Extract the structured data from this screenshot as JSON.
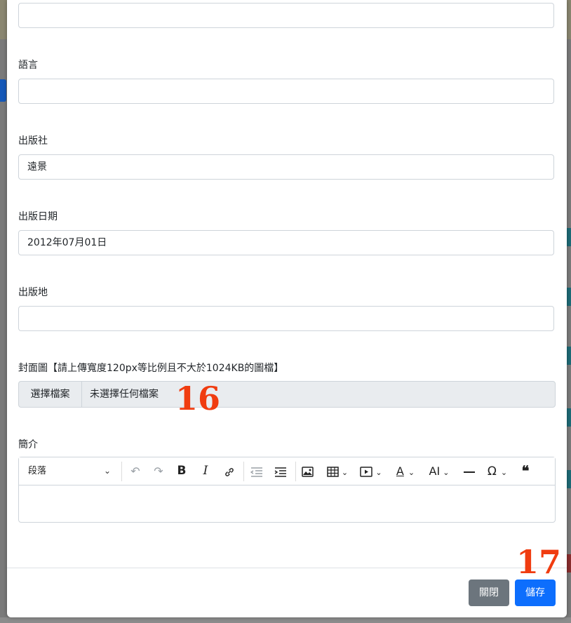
{
  "form": {
    "language_label": "語言",
    "language_value": "",
    "publisher_label": "出版社",
    "publisher_value": "遠景",
    "pub_date_label": "出版日期",
    "pub_date_value": "2012年07月01日",
    "pub_place_label": "出版地",
    "pub_place_value": "",
    "cover_label": "封面圖【請上傳寬度120px等比例且不大於1024KB的圖檔】",
    "file_button": "選擇檔案",
    "file_status": "未選擇任何檔案",
    "intro_label": "簡介"
  },
  "editor": {
    "block_format": "段落",
    "icons": [
      "undo-icon",
      "redo-icon",
      "bold-icon",
      "italic-icon",
      "link-icon",
      "outdent-icon",
      "indent-icon",
      "image-icon",
      "table-icon",
      "media-icon",
      "font-color-icon",
      "font-size-icon",
      "horizontal-rule-icon",
      "special-char-icon",
      "blockquote-icon"
    ]
  },
  "footer": {
    "close_label": "關閉",
    "save_label": "儲存"
  },
  "annotations": {
    "step_file": "16",
    "step_save": "17"
  },
  "colors": {
    "primary": "#0d6efd",
    "secondary": "#6c757d",
    "annotation": "#f03c10"
  }
}
